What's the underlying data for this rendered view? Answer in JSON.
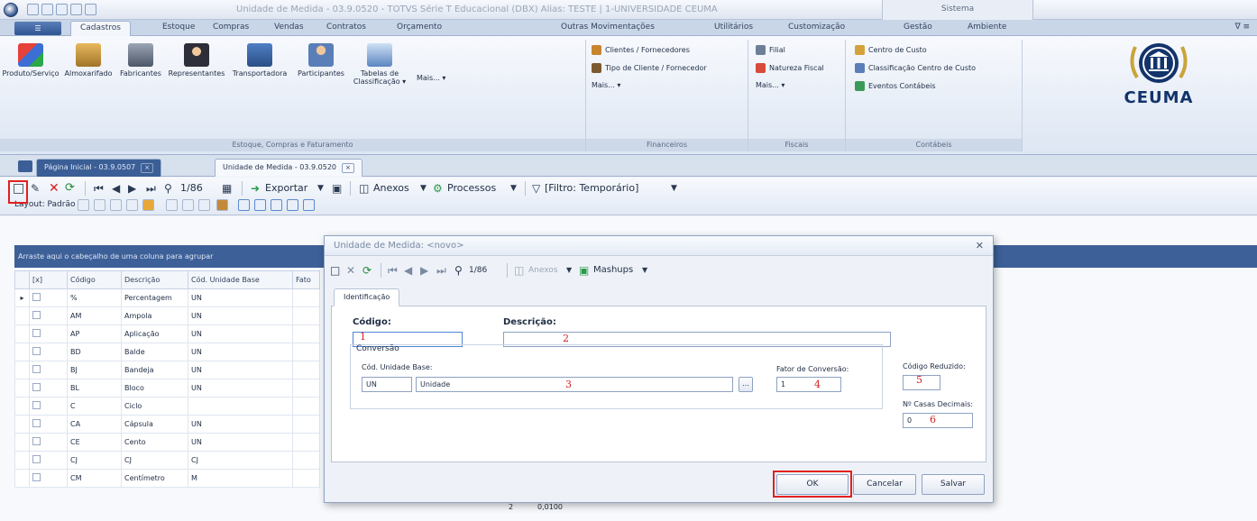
{
  "window": {
    "title": "Unidade de Medida - 03.9.0520 - TOTVS Série T Educacional (DBX) Alias: TESTE | 1-UNIVERSIDADE CEUMA",
    "system_tab": "Sistema"
  },
  "ribbon": {
    "tabs": [
      "Cadastros",
      "Estoque",
      "Compras",
      "Vendas",
      "Contratos",
      "Orçamento",
      "Outras Movimentações",
      "Utilitários",
      "Customização",
      "Gestão",
      "Ambiente"
    ],
    "groups": {
      "estoque": {
        "label": "Estoque, Compras e Faturamento",
        "buttons": [
          "Produto/Serviço",
          "Almoxarifado",
          "Fabricantes",
          "Representantes",
          "Transportadora",
          "Participantes",
          "Tabelas de Classificação ▾"
        ],
        "more": "Mais... ▾"
      },
      "financeiro": {
        "label": "Financeiros",
        "items": [
          "Clientes / Fornecedores",
          "Tipo de Cliente / Fornecedor"
        ],
        "more": "Mais... ▾"
      },
      "fiscais": {
        "label": "Fiscais",
        "items": [
          "Filial",
          "Natureza Fiscal"
        ],
        "more": "Mais... ▾"
      },
      "contabeis": {
        "label": "Contábeis",
        "items": [
          "Centro de Custo",
          "Classificação Centro de Custo",
          "Eventos Contábeis"
        ]
      }
    },
    "logo_text": "CEUMA"
  },
  "doc_tabs": [
    {
      "label": "Página Inicial - 03.9.0507",
      "active": false
    },
    {
      "label": "Unidade de Medida - 03.9.0520",
      "active": true
    }
  ],
  "toolbar": {
    "record_counter": "1/86",
    "export": "Exportar",
    "annexes": "Anexos",
    "processes": "Processos",
    "filter": "[Filtro: Temporário]",
    "layout_label": "Layout: Padrão ▾"
  },
  "grid": {
    "group_hint": "Arraste aqui o cabeçalho de uma coluna para agrupar",
    "columns": [
      "[x]",
      "Código",
      "Descrição",
      "Cód. Unidade Base",
      "Fato"
    ],
    "rows": [
      [
        "%",
        "Percentagem",
        "UN"
      ],
      [
        "AM",
        "Ampola",
        "UN"
      ],
      [
        "AP",
        "Aplicação",
        "UN"
      ],
      [
        "BD",
        "Balde",
        "UN"
      ],
      [
        "BJ",
        "Bandeja",
        "UN"
      ],
      [
        "BL",
        "Bloco",
        "UN"
      ],
      [
        "C",
        "Ciclo",
        ""
      ],
      [
        "CA",
        "Cápsula",
        "UN"
      ],
      [
        "CE",
        "Cento",
        "UN"
      ],
      [
        "CJ",
        "CJ",
        "CJ"
      ],
      [
        "CM",
        "Centímetro",
        "M"
      ]
    ],
    "last_row_factor": "0,0100",
    "last_row_extra": "2"
  },
  "dialog": {
    "title": "Unidade de Medida: <novo>",
    "record_counter": "1/86",
    "annexes": "Anexos",
    "mashups": "Mashups",
    "tab": "Identificação",
    "fields": {
      "codigo_label": "Código:",
      "descricao_label": "Descrição:",
      "conversao_label": "Conversão",
      "cod_unidade_base_label": "Cód. Unidade Base:",
      "cod_unidade_base_value": "UN",
      "unidade_desc_value": "Unidade",
      "fator_label": "Fator de Conversão:",
      "fator_value": "1",
      "codigo_reduzido_label": "Código Reduzido:",
      "casas_decimais_label": "Nº Casas Decimais:",
      "casas_decimais_value": "0"
    },
    "annotations": [
      "1",
      "2",
      "3",
      "4",
      "5",
      "6"
    ],
    "buttons": {
      "ok": "OK",
      "cancel": "Cancelar",
      "save": "Salvar"
    }
  }
}
